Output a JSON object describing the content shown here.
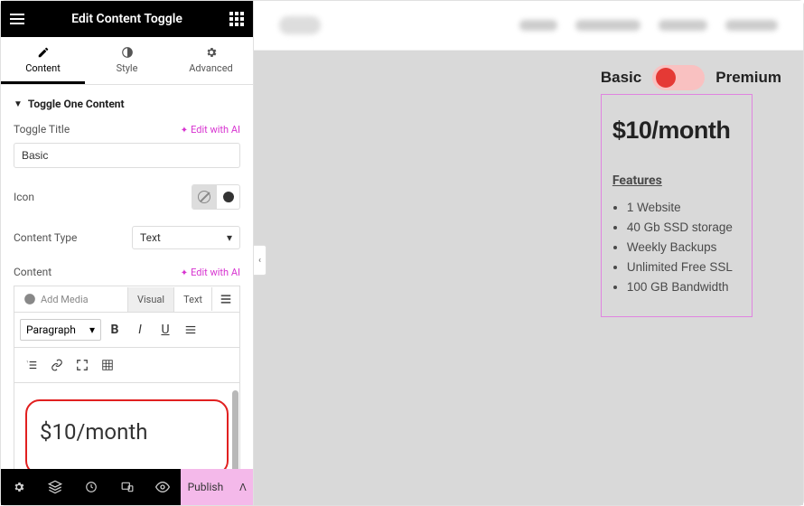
{
  "header": {
    "title": "Edit Content Toggle"
  },
  "tabs": {
    "content": "Content",
    "style": "Style",
    "advanced": "Advanced"
  },
  "section": {
    "title": "Toggle One Content",
    "toggle_title_label": "Toggle Title",
    "edit_with_ai": "Edit with AI",
    "toggle_title_value": "Basic",
    "icon_label": "Icon",
    "content_type_label": "Content Type",
    "content_type_value": "Text",
    "content_label": "Content",
    "add_media": "Add Media",
    "visual_tab": "Visual",
    "text_tab": "Text",
    "format_select": "Paragraph",
    "editor_content": "$10/month"
  },
  "footer": {
    "publish": "Publish"
  },
  "preview": {
    "label_left": "Basic",
    "label_right": "Premium",
    "price": "$10/month",
    "features_heading": "Features",
    "features": [
      "1 Website",
      "40 Gb SSD storage",
      "Weekly Backups",
      "Unlimited Free SSL",
      "100 GB Bandwidth"
    ]
  }
}
